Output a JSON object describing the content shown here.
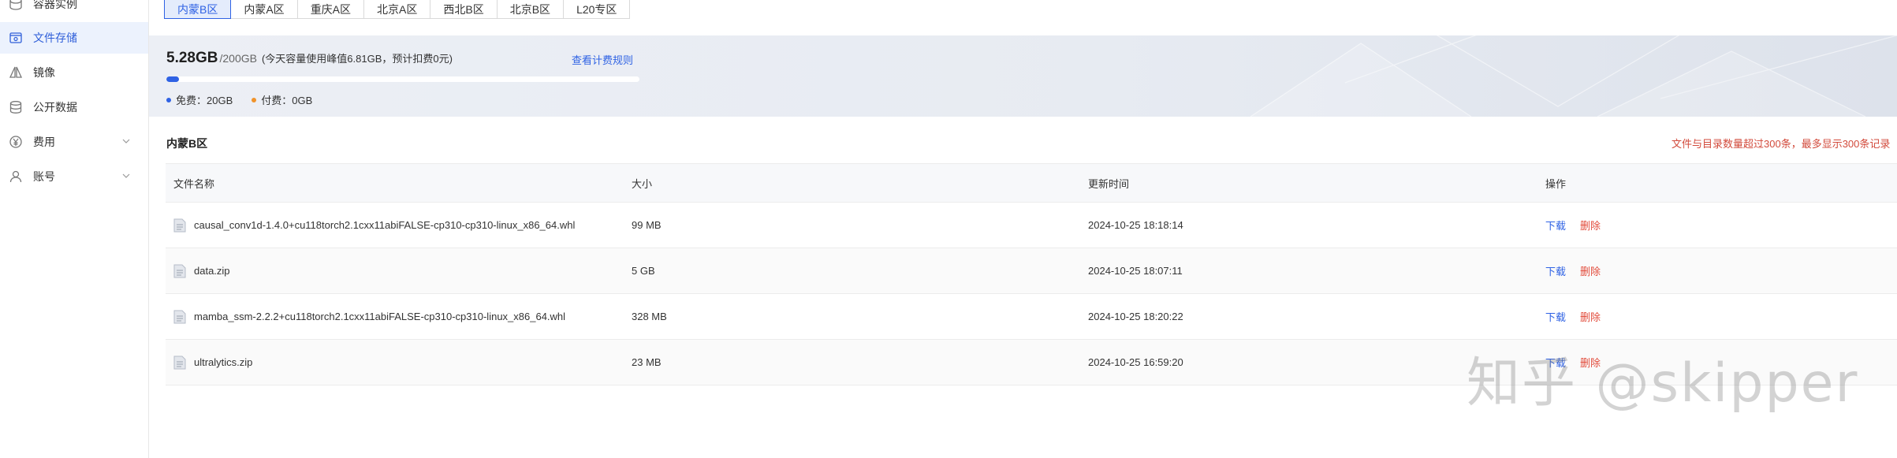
{
  "sidebar": {
    "items": [
      {
        "label": "容器实例",
        "icon": "container-icon"
      },
      {
        "label": "文件存储",
        "icon": "folder-storage-icon",
        "active": true
      },
      {
        "label": "镜像",
        "icon": "mirror-icon"
      },
      {
        "label": "公开数据",
        "icon": "database-icon"
      },
      {
        "label": "费用",
        "icon": "yen-icon",
        "has_chevron": true
      },
      {
        "label": "账号",
        "icon": "user-icon",
        "has_chevron": true
      }
    ]
  },
  "region_tabs": [
    "内蒙B区",
    "内蒙A区",
    "重庆A区",
    "北京A区",
    "西北B区",
    "北京B区",
    "L20专区"
  ],
  "active_region": "内蒙B区",
  "usage": {
    "used": "5.28GB",
    "total": "/200GB",
    "note": "(今天容量使用峰值6.81GB，预计扣费0元)",
    "billing_link": "查看计费规则",
    "progress_percent": 2.6,
    "free_label": "免费：20GB",
    "paid_label": "付费：0GB",
    "free_color": "#2f62e4",
    "paid_color": "#f0932b"
  },
  "section_title": "内蒙B区",
  "limit_note": "文件与目录数量超过300条，最多显示300条记录",
  "table": {
    "headers": [
      "文件名称",
      "大小",
      "更新时间",
      "操作"
    ],
    "rows": [
      {
        "name": "causal_conv1d-1.4.0+cu118torch2.1cxx11abiFALSE-cp310-cp310-linux_x86_64.whl",
        "size": "99 MB",
        "time": "2024-10-25 18:18:14"
      },
      {
        "name": "data.zip",
        "size": "5 GB",
        "time": "2024-10-25 18:07:11"
      },
      {
        "name": "mamba_ssm-2.2.2+cu118torch2.1cxx11abiFALSE-cp310-cp310-linux_x86_64.whl",
        "size": "328 MB",
        "time": "2024-10-25 18:20:22"
      },
      {
        "name": "ultralytics.zip",
        "size": "23 MB",
        "time": "2024-10-25 16:59:20"
      }
    ],
    "download_label": "下载",
    "delete_label": "删除"
  },
  "watermark": "知乎 @skipper"
}
